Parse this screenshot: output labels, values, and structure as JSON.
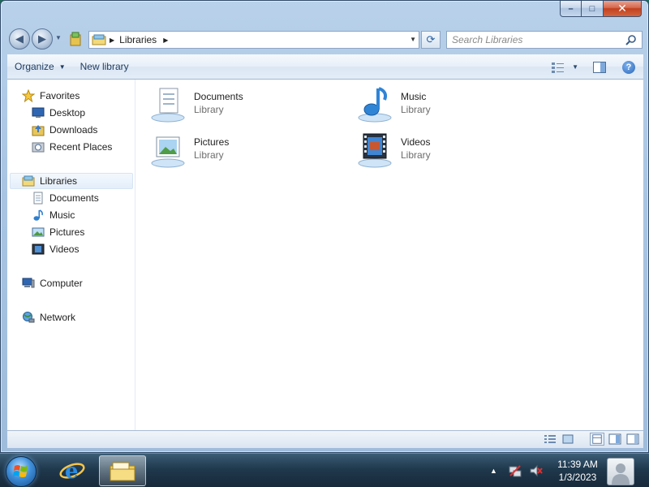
{
  "window": {
    "caption_buttons": {
      "minimize": "–",
      "maximize": "□",
      "close": "✕"
    }
  },
  "address_bar": {
    "breadcrumb": [
      "Libraries"
    ],
    "search_placeholder": "Search Libraries"
  },
  "command_bar": {
    "organize_label": "Organize",
    "new_library_label": "New library"
  },
  "navigation_pane": {
    "favorites": {
      "label": "Favorites",
      "items": [
        {
          "label": "Desktop",
          "icon": "desktop-icon"
        },
        {
          "label": "Downloads",
          "icon": "downloads-icon"
        },
        {
          "label": "Recent Places",
          "icon": "recent-places-icon"
        }
      ]
    },
    "libraries": {
      "label": "Libraries",
      "items": [
        {
          "label": "Documents",
          "icon": "documents-icon"
        },
        {
          "label": "Music",
          "icon": "music-icon"
        },
        {
          "label": "Pictures",
          "icon": "pictures-icon"
        },
        {
          "label": "Videos",
          "icon": "videos-icon"
        }
      ]
    },
    "computer": {
      "label": "Computer"
    },
    "network": {
      "label": "Network"
    }
  },
  "libraries_view": {
    "items": [
      {
        "name": "Documents",
        "type": "Library",
        "icon": "documents-library-icon"
      },
      {
        "name": "Music",
        "type": "Library",
        "icon": "music-library-icon"
      },
      {
        "name": "Pictures",
        "type": "Library",
        "icon": "pictures-library-icon"
      },
      {
        "name": "Videos",
        "type": "Library",
        "icon": "videos-library-icon"
      }
    ]
  },
  "taskbar": {
    "clock": {
      "time": "11:39 AM",
      "date": "1/3/2023"
    }
  },
  "colors": {
    "accent": "#1e3a5f",
    "desktop": "#1d6a5a",
    "secondary_text": "#6d6d6d"
  }
}
